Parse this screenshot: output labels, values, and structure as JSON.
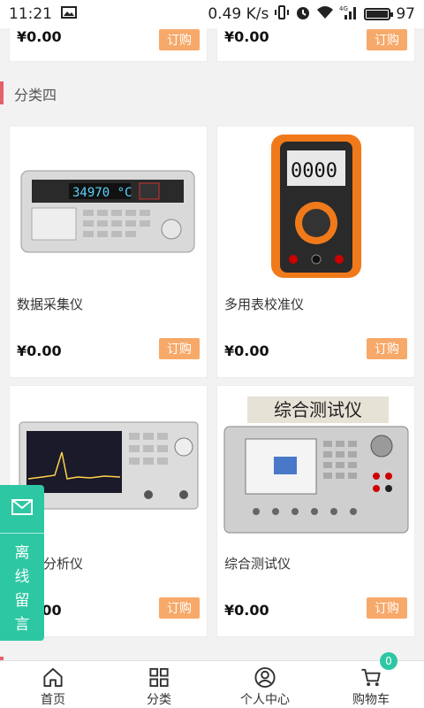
{
  "status_bar": {
    "time": "11:21",
    "net_speed": "0.49 K/s",
    "signal": "4G",
    "battery": "97",
    "battery_fraction": 0.97
  },
  "top_partial": {
    "left_price": "¥0.00",
    "left_button": "订购",
    "right_price": "¥0.00",
    "right_button": "订购"
  },
  "section": {
    "title": "分类四",
    "accent": "#e4606a"
  },
  "products": [
    {
      "name": "数据采集仪",
      "price": "¥0.00",
      "button": "订购",
      "icon": "data-acquisition-device-image"
    },
    {
      "name": "多用表校准仪",
      "price": "¥0.00",
      "button": "订购",
      "icon": "multimeter-image"
    },
    {
      "name": "频谱分析仪",
      "price": "¥0.00",
      "button": "订购",
      "icon": "spectrum-analyzer-image"
    },
    {
      "name": "综合测试仪",
      "price": "¥0.00",
      "button": "订购",
      "icon": "comprehensive-tester-image",
      "image_caption": "综合测试仪"
    }
  ],
  "float_message": {
    "label": "离线留言",
    "icon": "mail-icon",
    "color": "#2ec7a3"
  },
  "bottom_nav": [
    {
      "label": "首页",
      "icon": "home-icon"
    },
    {
      "label": "分类",
      "icon": "grid-icon"
    },
    {
      "label": "个人中心",
      "icon": "user-icon"
    },
    {
      "label": "购物车",
      "icon": "cart-icon",
      "badge": "0"
    }
  ],
  "colors": {
    "order_button": "#f7a96a",
    "badge": "#2ec7a3"
  }
}
